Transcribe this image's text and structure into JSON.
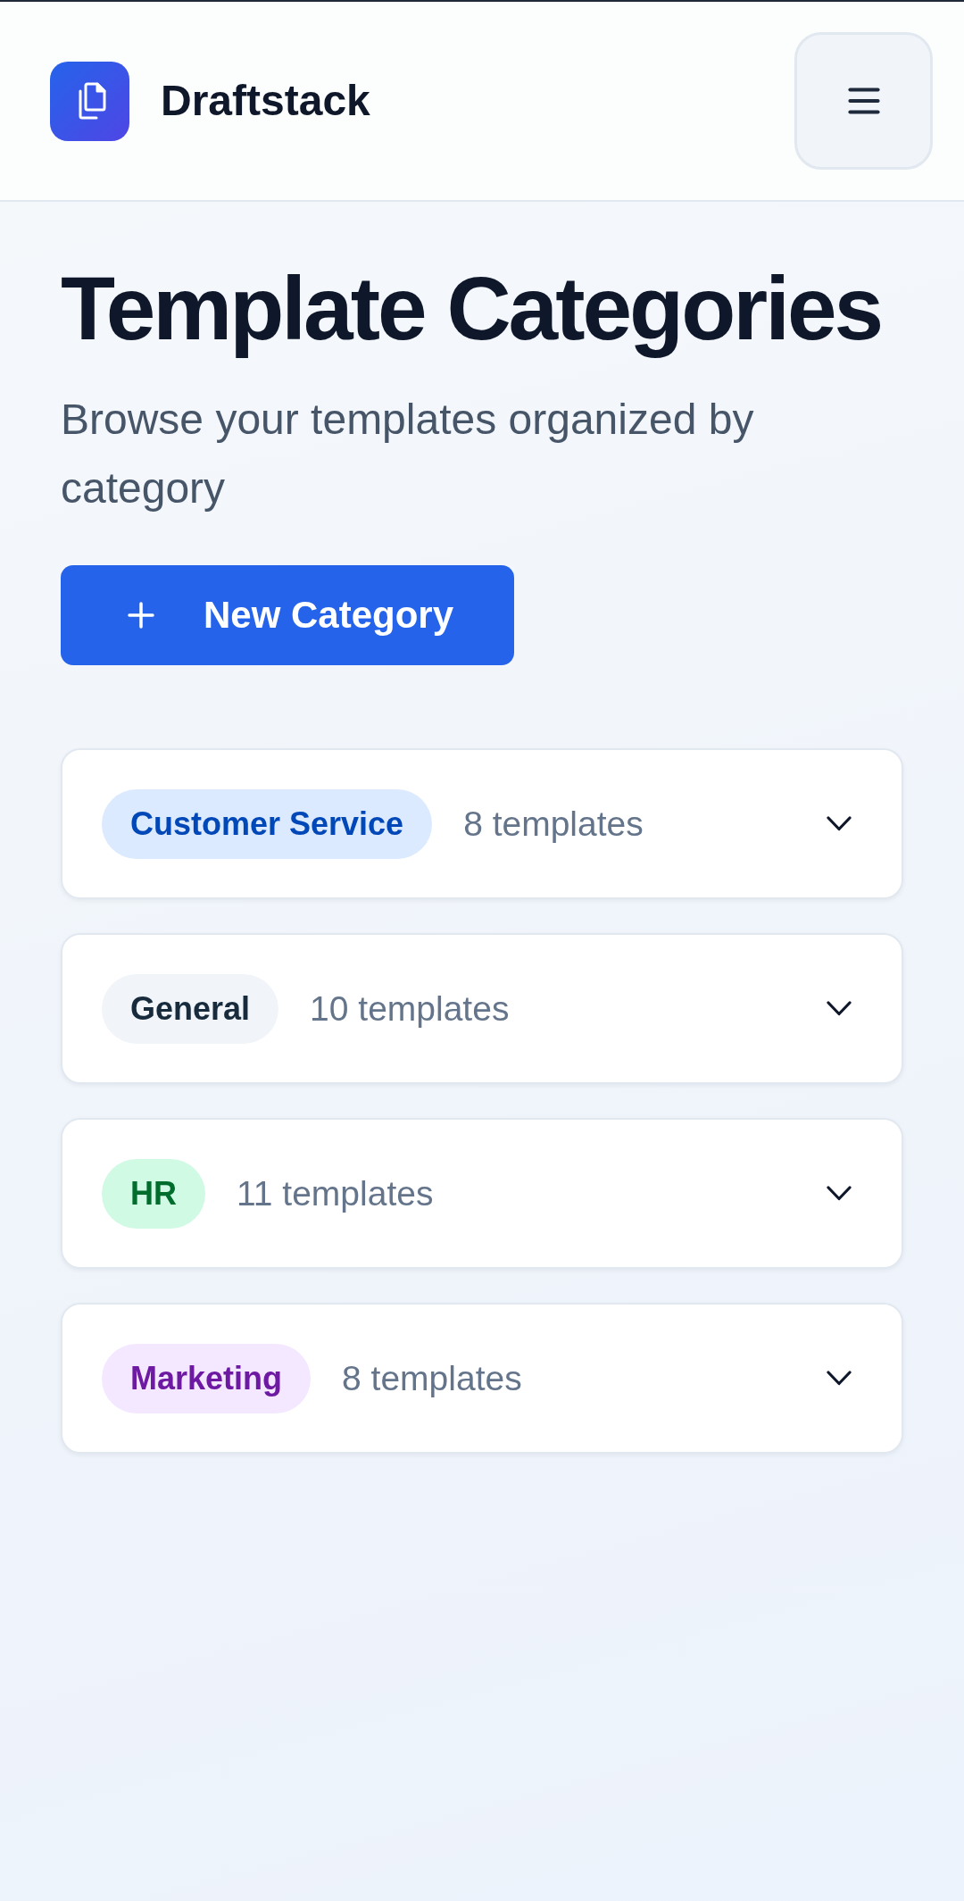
{
  "header": {
    "app_name": "Draftstack"
  },
  "page": {
    "title": "Template Categories",
    "subtitle": "Browse your templates organized by category",
    "new_button": {
      "label": "New Category"
    }
  },
  "categories": [
    {
      "name": "Customer Service",
      "count": "8 templates",
      "color": "#dbeafe",
      "expanded": false
    },
    {
      "name": "General",
      "count": "10 templates",
      "color": "#f1f5f9",
      "expanded": false
    },
    {
      "name": "HR",
      "count": "11 templates",
      "color": "#d1fae5",
      "expanded": false
    },
    {
      "name": "Marketing",
      "count": "8 templates",
      "color": "#f3e8ff",
      "expanded": false
    }
  ]
}
